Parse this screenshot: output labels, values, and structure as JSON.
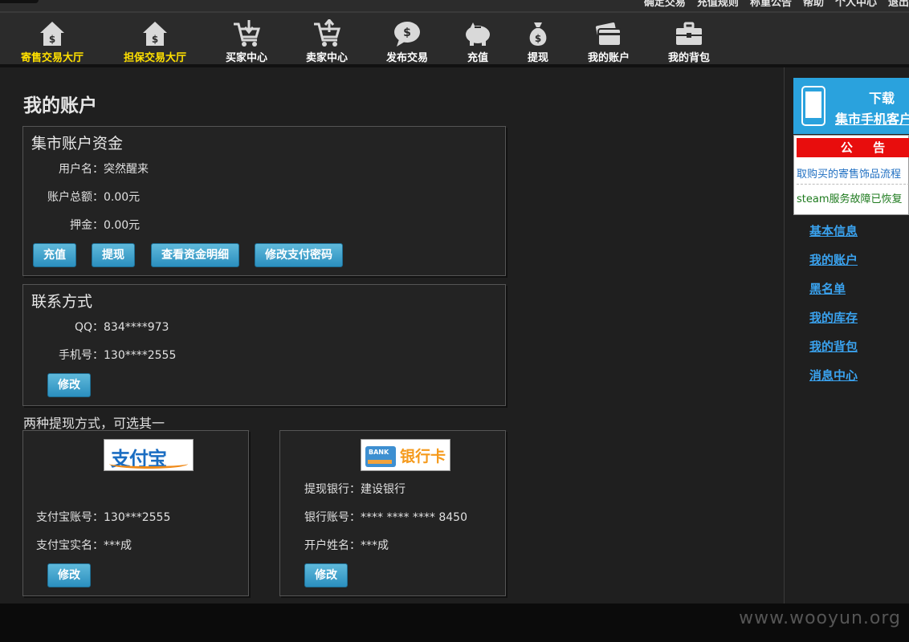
{
  "topbar": {
    "links": [
      "确定交易",
      "充值规则",
      "称重公告",
      "帮助",
      "个人中心",
      "退出"
    ]
  },
  "nav": {
    "items": [
      {
        "label": "寄售交易大厅",
        "icon": "house-dollar-icon",
        "highlight": true
      },
      {
        "label": "担保交易大厅",
        "icon": "house-dollar-icon",
        "highlight": true
      },
      {
        "label": "买家中心",
        "icon": "cart-download-icon",
        "highlight": false
      },
      {
        "label": "卖家中心",
        "icon": "cart-upload-icon",
        "highlight": false
      },
      {
        "label": "发布交易",
        "icon": "speech-dollar-icon",
        "highlight": false
      },
      {
        "label": "充值",
        "icon": "piggy-bank-icon",
        "highlight": false
      },
      {
        "label": "提现",
        "icon": "money-bag-icon",
        "highlight": false
      },
      {
        "label": "我的账户",
        "icon": "wallet-card-icon",
        "highlight": false
      },
      {
        "label": "我的背包",
        "icon": "briefcase-icon",
        "highlight": false
      }
    ]
  },
  "page": {
    "title": "我的账户"
  },
  "funds": {
    "title": "集市账户资金",
    "username_label": "用户名：",
    "username": "突然醒来",
    "balance_label": "账户总额：",
    "balance": "0.00元",
    "deposit_label": "押金：",
    "deposit": "0.00元",
    "buttons": {
      "recharge": "充值",
      "withdraw": "提现",
      "details": "查看资金明细",
      "change_pay_password": "修改支付密码"
    }
  },
  "contact": {
    "title": "联系方式",
    "qq_label": "QQ：",
    "qq": "834****973",
    "phone_label": "手机号：",
    "phone": "130****2555",
    "edit": "修改"
  },
  "withdraw_note": "两种提现方式，可选其一",
  "alipay": {
    "logo_text": "支付宝",
    "account_label": "支付宝账号：",
    "account": "130***2555",
    "name_label": "支付宝实名：",
    "name": "***成",
    "edit": "修改"
  },
  "bank": {
    "logo_card": "BANK",
    "logo_text": "银行卡",
    "bank_label": "提现银行：",
    "bank": "建设银行",
    "account_label": "银行账号：",
    "account": "**** **** **** 8450",
    "holder_label": "开户姓名：",
    "holder": "***成",
    "edit": "修改"
  },
  "sidebar": {
    "download_line1": "下载",
    "download_line2": "集市手机客户端",
    "notice_title": "公 告",
    "notice_items": [
      "取购买的寄售饰品流程",
      "steam服务故障已恢复"
    ],
    "links": [
      "基本信息",
      "我的账户",
      "黑名单",
      "我的库存",
      "我的背包",
      "消息中心"
    ]
  },
  "watermark": "www.wooyun.org",
  "colors": {
    "nav_highlight": "#ffe000",
    "button_blue": "#2b8fbf",
    "link_blue": "#3aa2ee",
    "notice_red": "#e80d0d"
  }
}
